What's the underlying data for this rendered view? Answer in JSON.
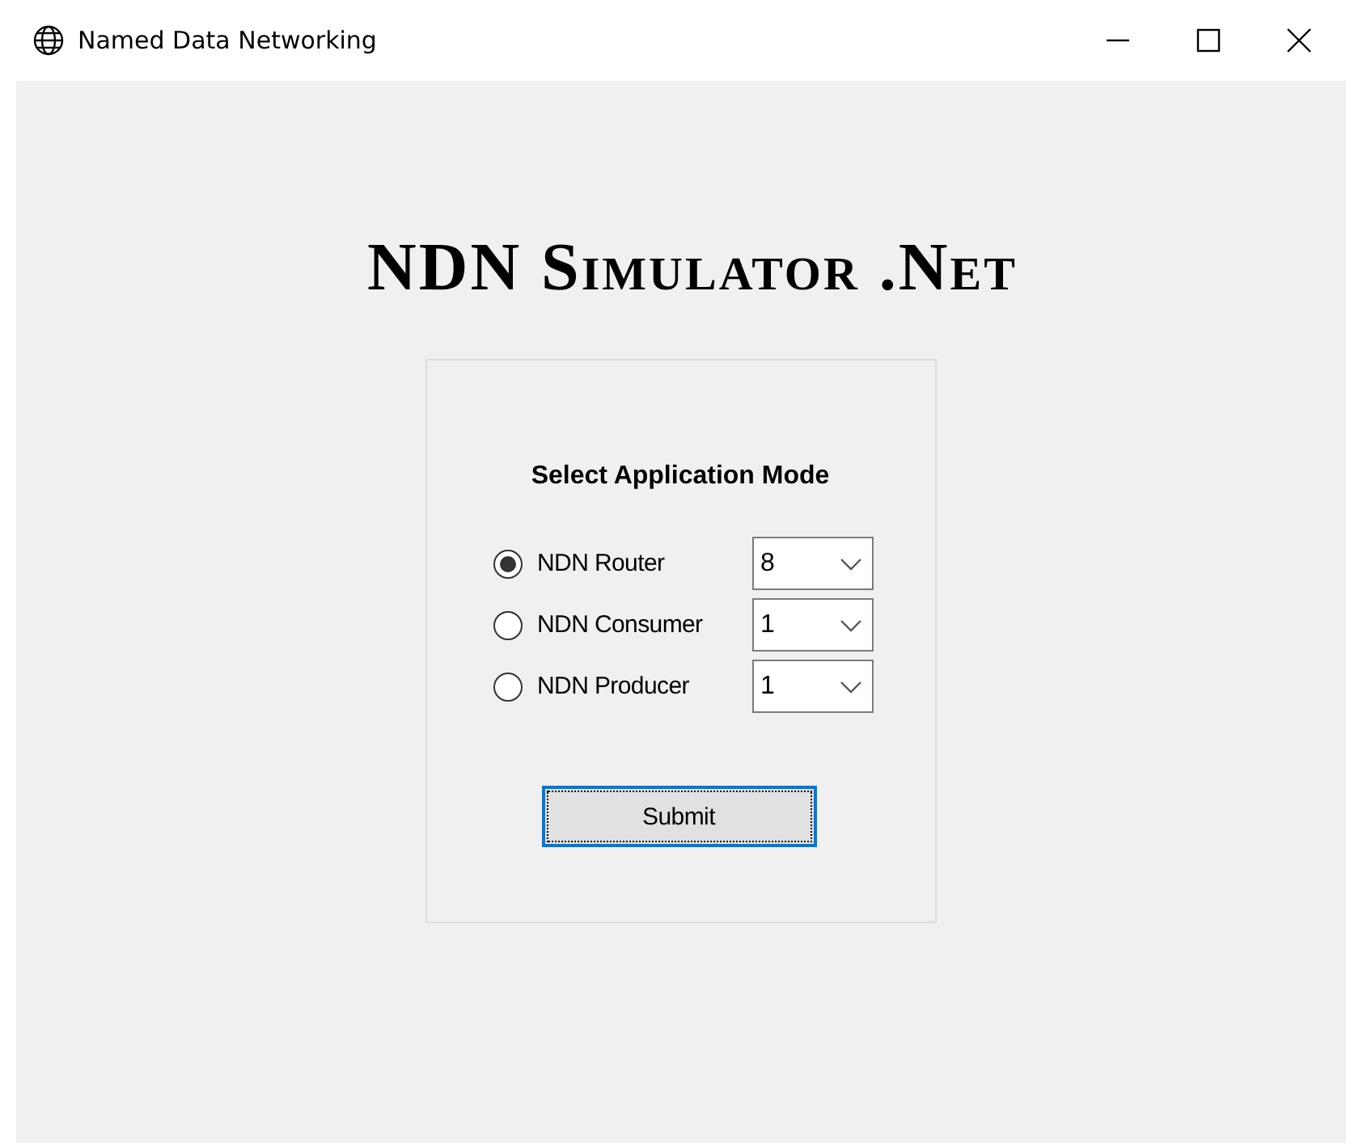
{
  "window": {
    "title": "Named Data Networking"
  },
  "heading": "NDN Simulator .Net",
  "group": {
    "title": "Select Application Mode",
    "modes": [
      {
        "label": "NDN Router",
        "selected": true,
        "count": "8"
      },
      {
        "label": "NDN Consumer",
        "selected": false,
        "count": "1"
      },
      {
        "label": "NDN Producer",
        "selected": false,
        "count": "1"
      }
    ]
  },
  "buttons": [
    {
      "label": "Submit",
      "focused": true
    }
  ]
}
